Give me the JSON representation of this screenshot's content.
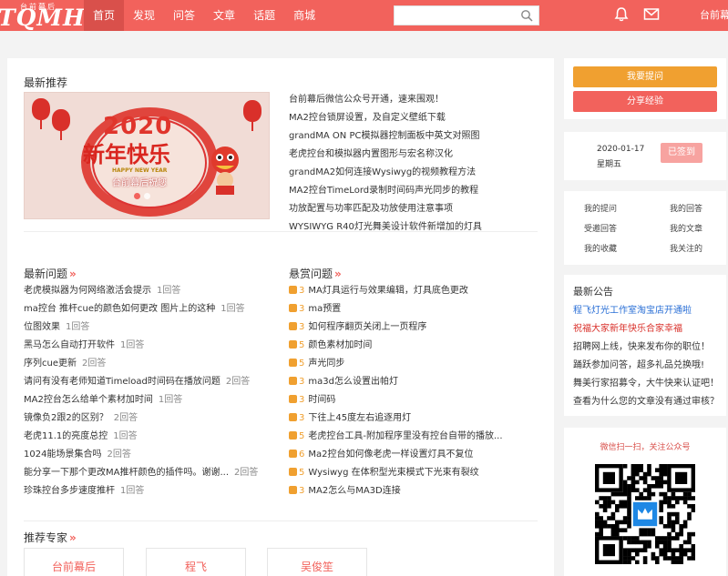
{
  "header": {
    "logo_main": "TQMH",
    "logo_sub": "台前幕后",
    "nav": [
      "首页",
      "发现",
      "问答",
      "文章",
      "话题",
      "商城"
    ],
    "active_nav": 0,
    "search_placeholder": "",
    "user": "台前幕"
  },
  "recommend": {
    "title": "最新推荐",
    "banner": {
      "year": "2020",
      "greeting": "新年快乐",
      "english": "HAPPY NEW YEAR",
      "caption": "台前幕后祝您",
      "active_dot": 0,
      "dot_count": 2
    },
    "headlines": [
      "台前幕后微信公众号开通，速来围观！",
      "MA2控台锁屏设置，及自定义壁纸下载",
      "grandMA ON PC模拟器控制面板中英文对照图",
      "老虎控台和模拟器内置图形与宏名称汉化",
      "grandMA2如何连接Wysiwyg的视频教程方法",
      "MA2控台TimeLord录制时间码声光同步的教程",
      "功放配置与功率匹配及功放使用注意事项",
      "WYSIWYG R40灯光舞美设计软件新增加的灯具"
    ]
  },
  "latest_questions": {
    "title": "最新问题",
    "more": "»",
    "items": [
      {
        "title": "老虎模拟器为何网络激活会提示",
        "count": "1回答"
      },
      {
        "title": "ma控台 推杆cue的颜色如何更改 图片上的这种",
        "count": "1回答"
      },
      {
        "title": "位图效果",
        "count": "1回答"
      },
      {
        "title": "黑马怎么自动打开软件",
        "count": "1回答"
      },
      {
        "title": "序列cue更新",
        "count": "2回答"
      },
      {
        "title": "请问有没有老师知道Timeload时间码在播放问题",
        "count": "2回答"
      },
      {
        "title": "MA2控台怎么给单个素材加时间",
        "count": "1回答"
      },
      {
        "title": "镜像负2跟2的区别？",
        "count": "2回答"
      },
      {
        "title": "老虎11.1的亮度总控",
        "count": "1回答"
      },
      {
        "title": "1024能场景集合吗",
        "count": "2回答"
      },
      {
        "title": "能分享一下那个更改MA推杆颜色的插件吗。谢谢...",
        "count": "2回答"
      },
      {
        "title": "珍珠控台多步速度推杆",
        "count": "1回答"
      }
    ]
  },
  "bounty_questions": {
    "title": "悬赏问题",
    "more": "»",
    "items": [
      {
        "bounty": "3",
        "title": "MA灯具运行与效果编辑，灯具底色更改"
      },
      {
        "bounty": "3",
        "title": "ma预置"
      },
      {
        "bounty": "3",
        "title": "如何程序翻页关闭上一页程序"
      },
      {
        "bounty": "5",
        "title": "颜色素材加时间"
      },
      {
        "bounty": "5",
        "title": "声光同步"
      },
      {
        "bounty": "3",
        "title": "ma3d怎么设置出帕灯"
      },
      {
        "bounty": "3",
        "title": "时间码"
      },
      {
        "bounty": "3",
        "title": "下往上45度左右追逐用灯"
      },
      {
        "bounty": "5",
        "title": "老虎控台工具-附加程序里没有控台自带的播放..."
      },
      {
        "bounty": "6",
        "title": "Ma2控台如何像老虎一样设置灯具不复位"
      },
      {
        "bounty": "5",
        "title": "Wysiwyg 在体积型光束模式下光束有裂纹"
      },
      {
        "bounty": "3",
        "title": "MA2怎么与MA3D连接"
      }
    ]
  },
  "experts": {
    "title": "推荐专家",
    "more": "»",
    "names": [
      "台前幕后",
      "程飞",
      "吴俊笙"
    ]
  },
  "sidebar": {
    "ask_button": "我要提问",
    "share_button": "分享经验",
    "date": "2020-01-17",
    "weekday": "星期五",
    "sign_button": "已签到",
    "user_links": [
      "我的提问",
      "我的回答",
      "受邀回答",
      "我的文章",
      "我的收藏",
      "我关注的"
    ],
    "notice_title": "最新公告",
    "notices": [
      {
        "text": "程飞灯光工作室淘宝店开通啦",
        "color": "#2a6fd6"
      },
      {
        "text": "祝福大家新年快乐合家幸福",
        "color": "#d9302a"
      },
      {
        "text": "招聘网上线，快来发布你的职位！",
        "color": "#333333"
      },
      {
        "text": "踊跃参加问答，超多礼品兑换哦!",
        "color": "#333333"
      },
      {
        "text": "舞美行家招募令，大牛快来认证吧！",
        "color": "#333333"
      },
      {
        "text": "查看为什么您的文章没有通过审核？",
        "color": "#333333"
      }
    ],
    "qr_title": "微信扫一扫，关注公众号"
  },
  "colors": {
    "brand": "#f2625c",
    "accent_orange": "#f0a030"
  }
}
